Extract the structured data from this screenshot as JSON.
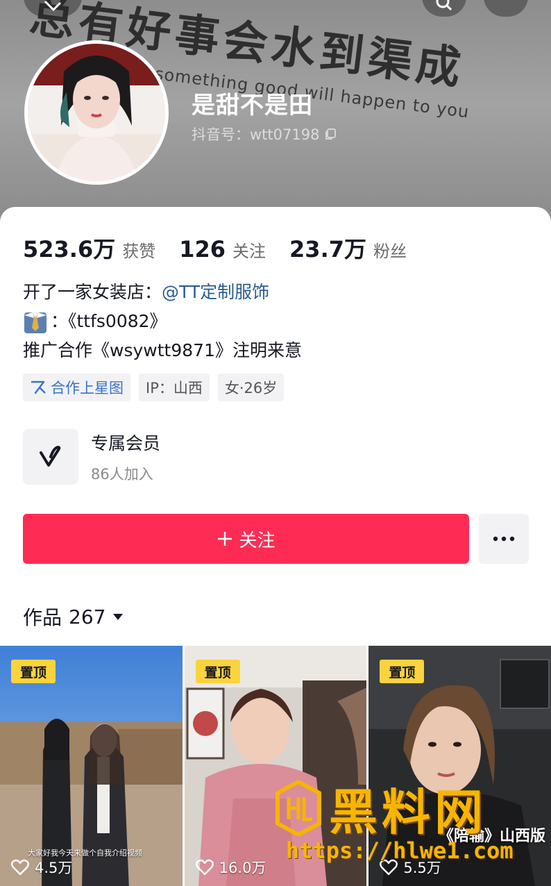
{
  "header": {
    "slogan": "总有好事会水到渠成",
    "slogan_sub": "something good will happen to you",
    "nickname": "是甜不是田",
    "douyin_id": "抖音号：wtt07198"
  },
  "stats": [
    {
      "value": "523.6万",
      "label": "获赞"
    },
    {
      "value": "126",
      "label": "关注"
    },
    {
      "value": "23.7万",
      "label": "粉丝"
    }
  ],
  "bio": {
    "line1_text": "开了一家女装店：",
    "line1_mention": "@TT定制服饰",
    "line2_text": "：《ttfs0082》",
    "line3_text": "推广合作《wsywtt9871》注明来意"
  },
  "tags": {
    "star": "合作上星图",
    "ip": "IP：山西",
    "gender_age": "女·26岁"
  },
  "member": {
    "title": "专属会员",
    "count": "86人加入"
  },
  "actions": {
    "follow_label": "关注"
  },
  "works": {
    "label": "作品",
    "count": "267"
  },
  "videos": [
    {
      "pin": "置顶",
      "likes": "4.5万",
      "caption": "大家好我今天来做个自我介绍视频"
    },
    {
      "pin": "置顶",
      "likes": "16.0万",
      "caption": ""
    },
    {
      "pin": "置顶",
      "likes": "5.5万",
      "caption": "《陪输》山西版"
    }
  ],
  "watermark": {
    "title": "黑料网",
    "url": "https://hlwe1.com"
  },
  "colors": {
    "accent": "#fe2c55",
    "mention": "#2a5d8f",
    "pin": "#fbd33d",
    "watermark": "#f7b500"
  }
}
